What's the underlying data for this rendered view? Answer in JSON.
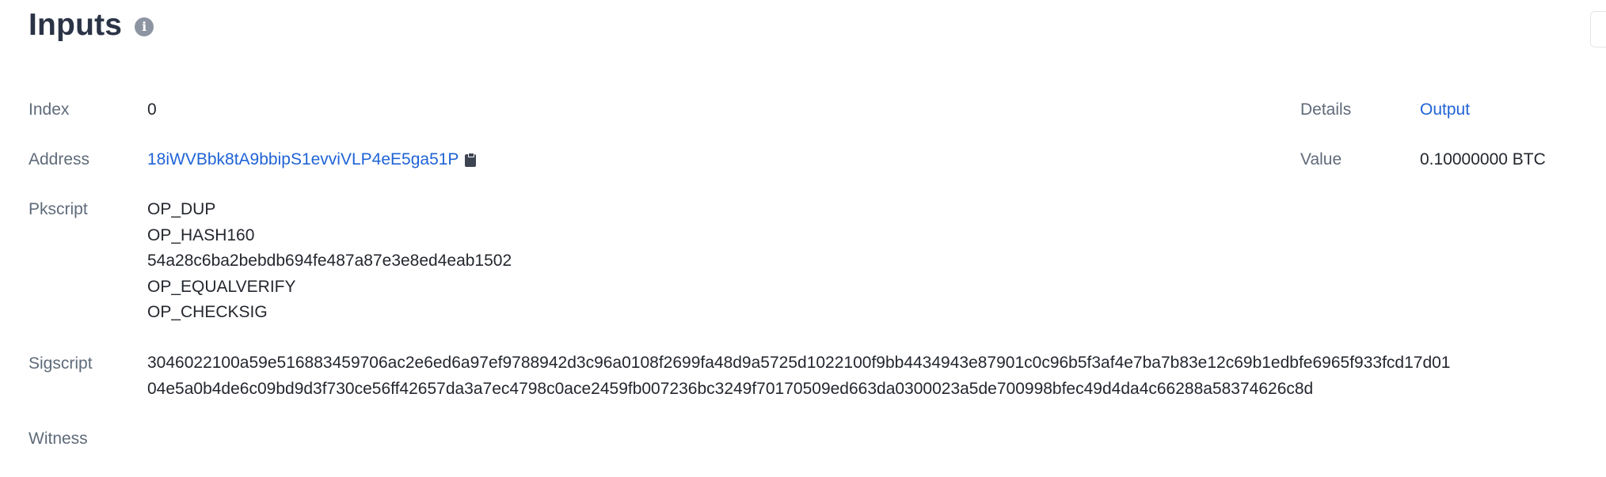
{
  "header": {
    "title": "Inputs",
    "info_icon": "info-icon"
  },
  "fields": {
    "index": {
      "label": "Index",
      "value": "0"
    },
    "address": {
      "label": "Address",
      "value": "18iWVBbk8tA9bbipS1evviVLP4eE5ga51P",
      "copy_icon": "clipboard-icon"
    },
    "pkscript": {
      "label": "Pkscript",
      "lines": [
        "OP_DUP",
        "OP_HASH160",
        "54a28c6ba2bebdb694fe487a87e3e8ed4eab1502",
        "OP_EQUALVERIFY",
        "OP_CHECKSIG"
      ]
    },
    "sigscript": {
      "label": "Sigscript",
      "lines": [
        "3046022100a59e516883459706ac2e6ed6a97ef9788942d3c96a0108f2699fa48d9a5725d1022100f9bb4434943e87901c0c96b5f3af4e7ba7b83e12c69b1edbfe6965f933fcd17d01",
        "04e5a0b4de6c09bd9d3f730ce56ff42657da3a7ec4798c0ace2459fb007236bc3249f70170509ed663da0300023a5de700998bfec49d4da4c66288a58374626c8d"
      ]
    },
    "witness": {
      "label": "Witness"
    },
    "details": {
      "label": "Details",
      "value": "Output"
    },
    "amount": {
      "label": "Value",
      "value": "0.10000000 BTC"
    }
  },
  "colors": {
    "link": "#1f63d6",
    "label": "#5f6b7a",
    "title": "#2b3446"
  }
}
